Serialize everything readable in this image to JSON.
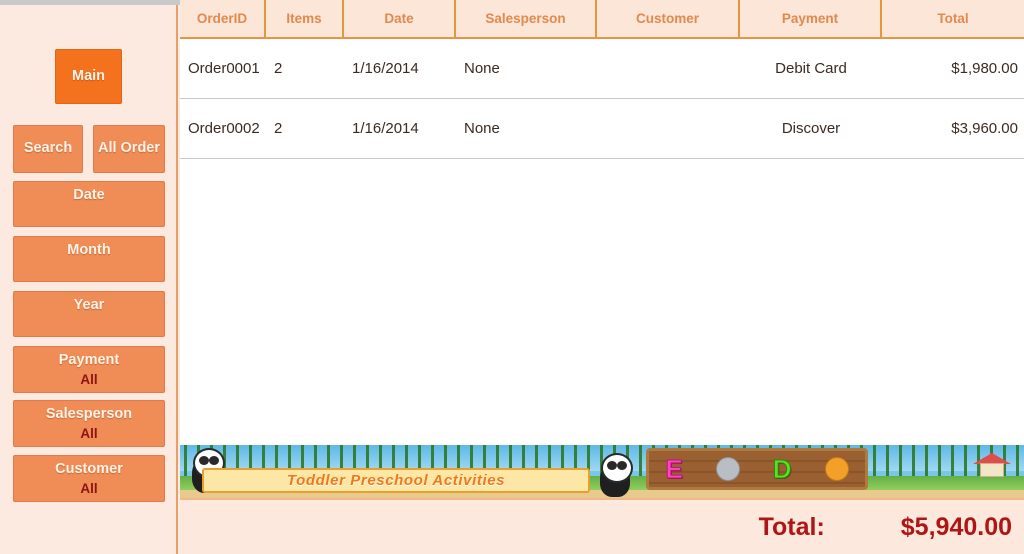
{
  "sidebar": {
    "main_button": {
      "label": "Main"
    },
    "search_button": {
      "label": "Search"
    },
    "all_order_button": {
      "label": "All Order"
    },
    "filters": [
      {
        "name": "date",
        "label": "Date",
        "value": ""
      },
      {
        "name": "month",
        "label": "Month",
        "value": ""
      },
      {
        "name": "year",
        "label": "Year",
        "value": ""
      },
      {
        "name": "payment",
        "label": "Payment",
        "value": "All"
      },
      {
        "name": "salesperson",
        "label": "Salesperson",
        "value": "All"
      },
      {
        "name": "customer",
        "label": "Customer",
        "value": "All"
      }
    ]
  },
  "table": {
    "columns": [
      {
        "key": "orderid",
        "label": "OrderID"
      },
      {
        "key": "items",
        "label": "Items"
      },
      {
        "key": "date",
        "label": "Date"
      },
      {
        "key": "salesperson",
        "label": "Salesperson"
      },
      {
        "key": "customer",
        "label": "Customer"
      },
      {
        "key": "payment",
        "label": "Payment"
      },
      {
        "key": "total",
        "label": "Total"
      }
    ],
    "rows": [
      {
        "orderid": "Order0001",
        "items": "2",
        "date": "1/16/2014",
        "salesperson": "None",
        "customer": "",
        "payment": "Debit Card",
        "total": "$1,980.00"
      },
      {
        "orderid": "Order0002",
        "items": "2",
        "date": "1/16/2014",
        "salesperson": "None",
        "customer": "",
        "payment": "Discover",
        "total": "$3,960.00"
      }
    ]
  },
  "footer": {
    "total_label": "Total:",
    "total_value": "$5,940.00"
  },
  "ad": {
    "title": "Toddler Preschool Activities",
    "sign_letters": [
      "E",
      "D"
    ]
  },
  "colors": {
    "accent_orange": "#F08C55",
    "active_orange": "#F4711E",
    "sidebar_bg": "#FCEAE0",
    "header_bg": "#FBE6D8",
    "header_text": "#E08A4E",
    "total_red": "#B01515",
    "filter_value_red": "#8C1414"
  }
}
